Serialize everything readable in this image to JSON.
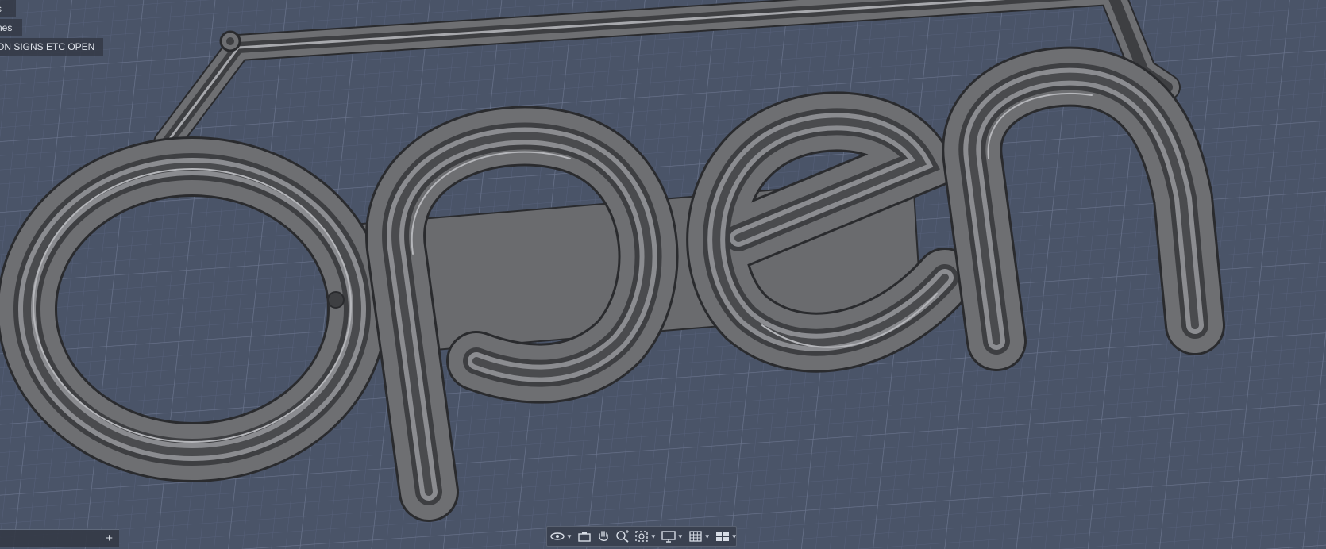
{
  "browser": {
    "items": [
      {
        "label": "s"
      },
      {
        "label": "nes"
      },
      {
        "label": "ON  SIGNS  ETC OPEN"
      }
    ]
  },
  "viewport": {
    "background": "#4a5468",
    "grid_minor": "#56607a",
    "grid_major": "#68728a",
    "model_fill": "#6e6f72",
    "model_dark": "#3e3f42",
    "model_light": "#9a9ba0",
    "model_text": "open"
  },
  "comments": {
    "add_label": "+"
  },
  "nav_toolbar": {
    "tools": [
      {
        "icon": "orbit-icon",
        "dropdown": true
      },
      {
        "icon": "look-at-icon",
        "dropdown": false
      },
      {
        "icon": "pan-icon",
        "dropdown": false
      },
      {
        "icon": "zoom-icon",
        "dropdown": false
      },
      {
        "icon": "fit-icon",
        "dropdown": true
      },
      {
        "icon": "display-settings-icon",
        "dropdown": true
      },
      {
        "icon": "grid-icon",
        "dropdown": true
      },
      {
        "icon": "viewports-icon",
        "dropdown": true
      }
    ]
  }
}
